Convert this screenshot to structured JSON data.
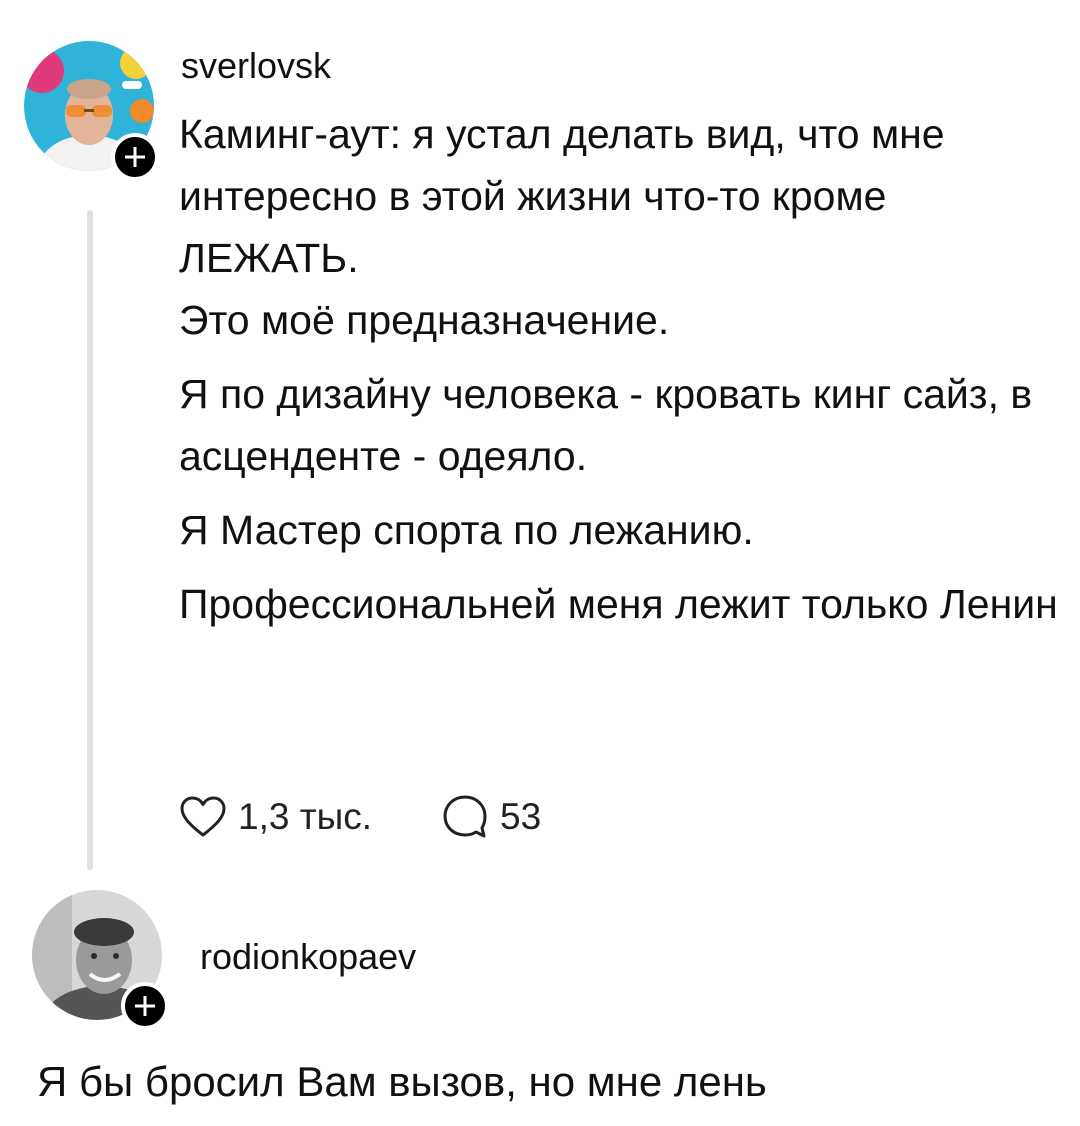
{
  "post": {
    "username": "sverlovsk",
    "paragraphs": [
      "Каминг-аут: я устал делать вид, что мне интересно в этой жизни что-то кроме ЛЕЖАТЬ.\nЭто моё предназначение.",
      "Я по дизайну человека - кровать кинг сайз, в асценденте - одеяло.",
      "Я Мастер спорта по лежанию.",
      "Профессиональней меня лежит только Ленин"
    ],
    "likes_count": "1,3 тыс.",
    "comments_count": "53"
  },
  "reply": {
    "username": "rodionkopaev",
    "text": "Я бы бросил Вам вызов, но мне лень"
  },
  "colors": {
    "text": "#111111",
    "thread_line": "#e1e1e1",
    "follow_badge": "#000000"
  },
  "icons": {
    "follow": "plus-icon",
    "like": "heart-icon",
    "comment": "speech-bubble-icon"
  }
}
